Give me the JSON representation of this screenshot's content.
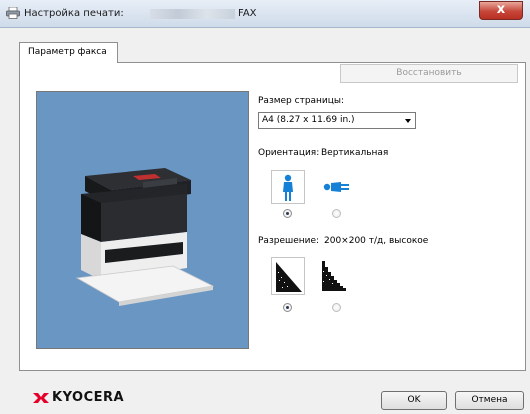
{
  "window": {
    "title_prefix": "Настройка печати:",
    "title_suffix": "FAX",
    "close_label": "x"
  },
  "tabs": [
    {
      "label": "Параметр факса"
    }
  ],
  "restore_label": "Восстановить",
  "page_size": {
    "label": "Размер страницы:",
    "value": "A4 (8.27 x 11.69 in.)"
  },
  "orientation": {
    "label": "Ориентация:",
    "value": "Вертикальная",
    "options": [
      {
        "icon": "portrait-person-icon",
        "checked": true
      },
      {
        "icon": "landscape-person-icon",
        "checked": false
      }
    ]
  },
  "resolution": {
    "label": "Разрешение:",
    "value": "200×200 т/д, высокое",
    "options": [
      {
        "icon": "fine-resolution-icon",
        "checked": true
      },
      {
        "icon": "coarse-resolution-icon",
        "checked": false
      }
    ]
  },
  "brand": "KYOCERA",
  "buttons": {
    "ok": "OK",
    "cancel": "Отмена"
  },
  "colors": {
    "accent": "#1581d6",
    "preview_bg": "#6996c3",
    "logo_red": "#e4002b"
  }
}
